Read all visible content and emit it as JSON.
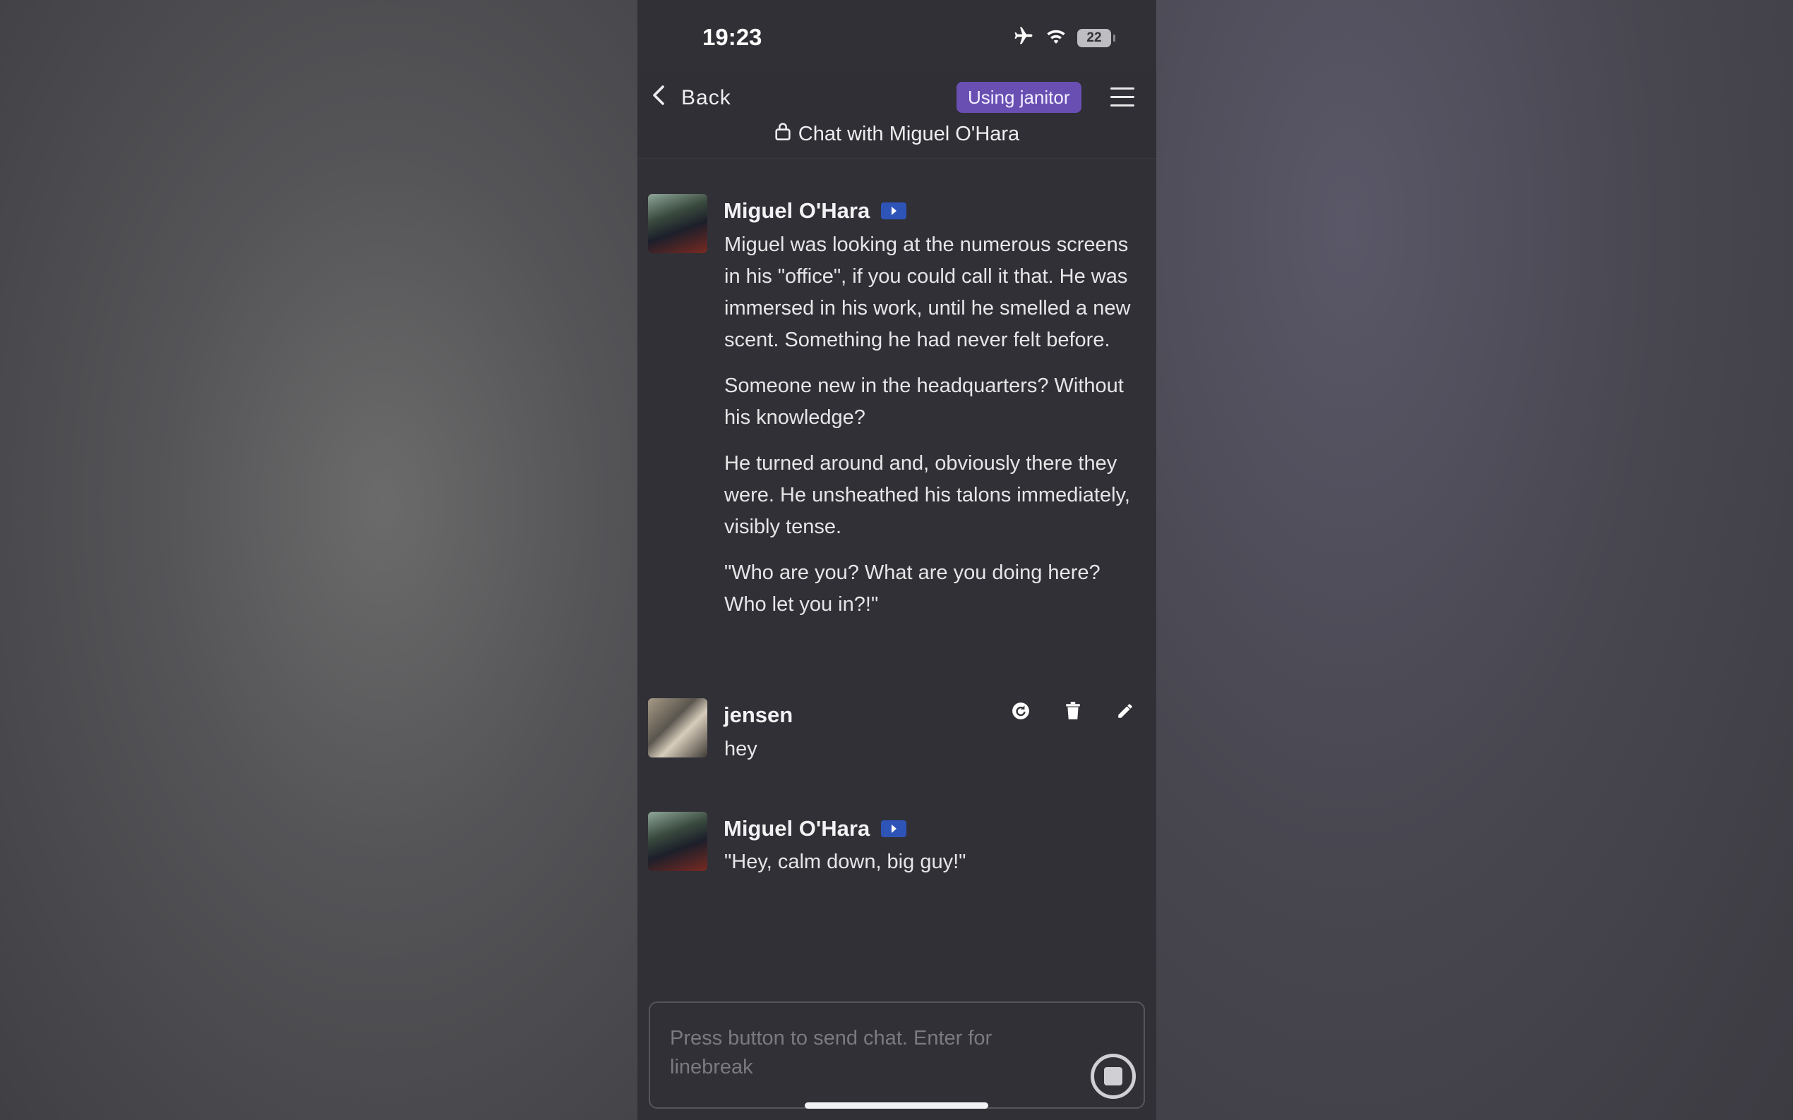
{
  "status": {
    "time": "19:23",
    "battery": "22"
  },
  "header": {
    "back_label": "Back",
    "model_badge": "Using janitor",
    "chat_title": "Chat with Miguel O'Hara"
  },
  "messages": [
    {
      "author": "Miguel O'Hara",
      "is_bot": true,
      "paragraphs": [
        "Miguel was looking at the numerous screens in his \"office\", if you could call it that. He was immersed in his work, until he smelled a new scent. Something he had never felt before.",
        "Someone new in the headquarters? Without his knowledge?",
        "He turned around and, obviously there they were. He unsheathed his talons immediately, visibly tense.",
        "\"Who are you? What are you doing here? Who let you in?!\""
      ]
    },
    {
      "author": "jensen",
      "is_bot": false,
      "paragraphs": [
        "hey"
      ]
    },
    {
      "author": "Miguel O'Hara",
      "is_bot": true,
      "paragraphs": [
        "\"Hey, calm down, big guy!\""
      ]
    }
  ],
  "composer": {
    "placeholder": "Press button to send chat. Enter for linebreak",
    "value": ""
  },
  "colors": {
    "badge": "#6a4fb3",
    "bot_badge": "#2e54b8",
    "background": "#303036"
  },
  "icons": [
    "airplane-icon",
    "wifi-icon",
    "battery-icon",
    "chevron-left-icon",
    "hamburger-menu-icon",
    "lock-icon",
    "bot-icon",
    "regenerate-icon",
    "trash-icon",
    "pencil-icon",
    "stop-icon"
  ]
}
